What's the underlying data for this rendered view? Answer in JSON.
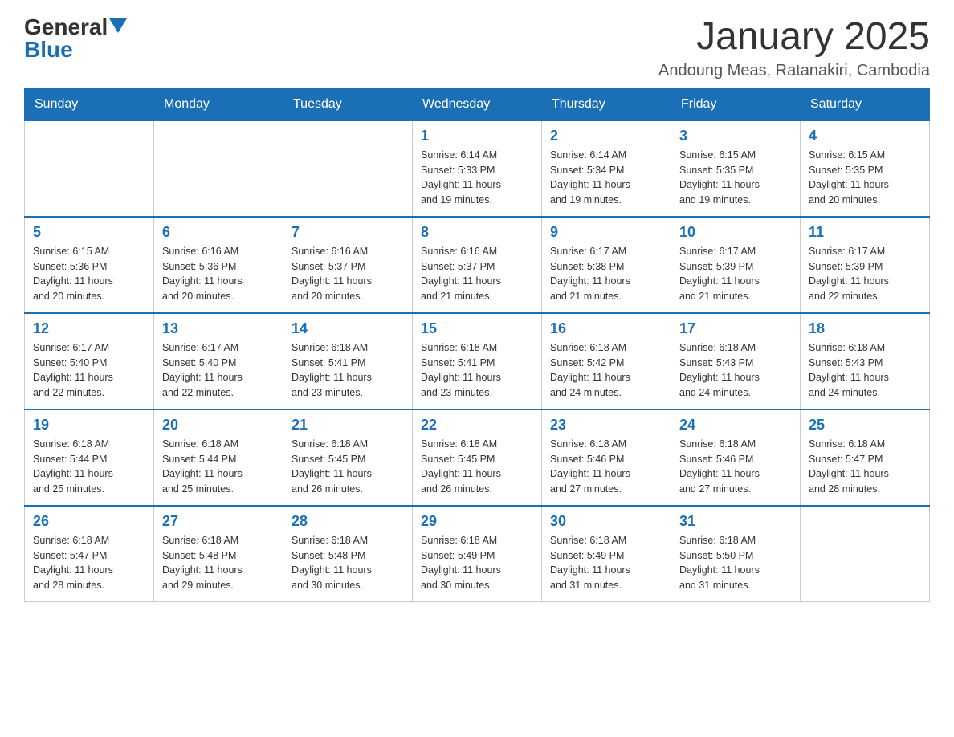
{
  "logo": {
    "general": "General",
    "blue": "Blue"
  },
  "title": "January 2025",
  "location": "Andoung Meas, Ratanakiri, Cambodia",
  "days_of_week": [
    "Sunday",
    "Monday",
    "Tuesday",
    "Wednesday",
    "Thursday",
    "Friday",
    "Saturday"
  ],
  "weeks": [
    [
      {
        "day": "",
        "info": ""
      },
      {
        "day": "",
        "info": ""
      },
      {
        "day": "",
        "info": ""
      },
      {
        "day": "1",
        "info": "Sunrise: 6:14 AM\nSunset: 5:33 PM\nDaylight: 11 hours\nand 19 minutes."
      },
      {
        "day": "2",
        "info": "Sunrise: 6:14 AM\nSunset: 5:34 PM\nDaylight: 11 hours\nand 19 minutes."
      },
      {
        "day": "3",
        "info": "Sunrise: 6:15 AM\nSunset: 5:35 PM\nDaylight: 11 hours\nand 19 minutes."
      },
      {
        "day": "4",
        "info": "Sunrise: 6:15 AM\nSunset: 5:35 PM\nDaylight: 11 hours\nand 20 minutes."
      }
    ],
    [
      {
        "day": "5",
        "info": "Sunrise: 6:15 AM\nSunset: 5:36 PM\nDaylight: 11 hours\nand 20 minutes."
      },
      {
        "day": "6",
        "info": "Sunrise: 6:16 AM\nSunset: 5:36 PM\nDaylight: 11 hours\nand 20 minutes."
      },
      {
        "day": "7",
        "info": "Sunrise: 6:16 AM\nSunset: 5:37 PM\nDaylight: 11 hours\nand 20 minutes."
      },
      {
        "day": "8",
        "info": "Sunrise: 6:16 AM\nSunset: 5:37 PM\nDaylight: 11 hours\nand 21 minutes."
      },
      {
        "day": "9",
        "info": "Sunrise: 6:17 AM\nSunset: 5:38 PM\nDaylight: 11 hours\nand 21 minutes."
      },
      {
        "day": "10",
        "info": "Sunrise: 6:17 AM\nSunset: 5:39 PM\nDaylight: 11 hours\nand 21 minutes."
      },
      {
        "day": "11",
        "info": "Sunrise: 6:17 AM\nSunset: 5:39 PM\nDaylight: 11 hours\nand 22 minutes."
      }
    ],
    [
      {
        "day": "12",
        "info": "Sunrise: 6:17 AM\nSunset: 5:40 PM\nDaylight: 11 hours\nand 22 minutes."
      },
      {
        "day": "13",
        "info": "Sunrise: 6:17 AM\nSunset: 5:40 PM\nDaylight: 11 hours\nand 22 minutes."
      },
      {
        "day": "14",
        "info": "Sunrise: 6:18 AM\nSunset: 5:41 PM\nDaylight: 11 hours\nand 23 minutes."
      },
      {
        "day": "15",
        "info": "Sunrise: 6:18 AM\nSunset: 5:41 PM\nDaylight: 11 hours\nand 23 minutes."
      },
      {
        "day": "16",
        "info": "Sunrise: 6:18 AM\nSunset: 5:42 PM\nDaylight: 11 hours\nand 24 minutes."
      },
      {
        "day": "17",
        "info": "Sunrise: 6:18 AM\nSunset: 5:43 PM\nDaylight: 11 hours\nand 24 minutes."
      },
      {
        "day": "18",
        "info": "Sunrise: 6:18 AM\nSunset: 5:43 PM\nDaylight: 11 hours\nand 24 minutes."
      }
    ],
    [
      {
        "day": "19",
        "info": "Sunrise: 6:18 AM\nSunset: 5:44 PM\nDaylight: 11 hours\nand 25 minutes."
      },
      {
        "day": "20",
        "info": "Sunrise: 6:18 AM\nSunset: 5:44 PM\nDaylight: 11 hours\nand 25 minutes."
      },
      {
        "day": "21",
        "info": "Sunrise: 6:18 AM\nSunset: 5:45 PM\nDaylight: 11 hours\nand 26 minutes."
      },
      {
        "day": "22",
        "info": "Sunrise: 6:18 AM\nSunset: 5:45 PM\nDaylight: 11 hours\nand 26 minutes."
      },
      {
        "day": "23",
        "info": "Sunrise: 6:18 AM\nSunset: 5:46 PM\nDaylight: 11 hours\nand 27 minutes."
      },
      {
        "day": "24",
        "info": "Sunrise: 6:18 AM\nSunset: 5:46 PM\nDaylight: 11 hours\nand 27 minutes."
      },
      {
        "day": "25",
        "info": "Sunrise: 6:18 AM\nSunset: 5:47 PM\nDaylight: 11 hours\nand 28 minutes."
      }
    ],
    [
      {
        "day": "26",
        "info": "Sunrise: 6:18 AM\nSunset: 5:47 PM\nDaylight: 11 hours\nand 28 minutes."
      },
      {
        "day": "27",
        "info": "Sunrise: 6:18 AM\nSunset: 5:48 PM\nDaylight: 11 hours\nand 29 minutes."
      },
      {
        "day": "28",
        "info": "Sunrise: 6:18 AM\nSunset: 5:48 PM\nDaylight: 11 hours\nand 30 minutes."
      },
      {
        "day": "29",
        "info": "Sunrise: 6:18 AM\nSunset: 5:49 PM\nDaylight: 11 hours\nand 30 minutes."
      },
      {
        "day": "30",
        "info": "Sunrise: 6:18 AM\nSunset: 5:49 PM\nDaylight: 11 hours\nand 31 minutes."
      },
      {
        "day": "31",
        "info": "Sunrise: 6:18 AM\nSunset: 5:50 PM\nDaylight: 11 hours\nand 31 minutes."
      },
      {
        "day": "",
        "info": ""
      }
    ]
  ]
}
